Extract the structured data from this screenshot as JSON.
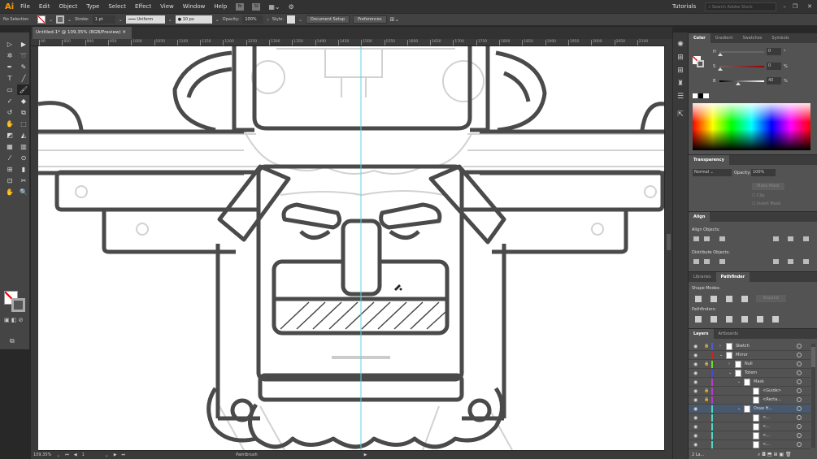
{
  "app": {
    "logo": "Ai",
    "menu": [
      "File",
      "Edit",
      "Object",
      "Type",
      "Select",
      "Effect",
      "View",
      "Window",
      "Help"
    ],
    "bridge": "Br",
    "stock": "St",
    "workspace": "Tutorials",
    "search_placeholder": "Search Adobe Stock"
  },
  "control": {
    "selection": "No Selection",
    "stroke_label": "Stroke:",
    "stroke_weight": "1 pt",
    "profile": "Uniform",
    "brush": "10 px",
    "opacity_label": "Opacity:",
    "opacity": "100%",
    "style_label": "Style:",
    "doc_setup": "Document Setup",
    "preferences": "Preferences"
  },
  "document": {
    "tab_title": "Untitled-1* @ 109,35% (RGB/Preview)",
    "ruler": [
      "00",
      "850",
      "900",
      "950",
      "1000",
      "1050",
      "1100",
      "1150",
      "1200",
      "1250",
      "1300",
      "1350",
      "1400",
      "1450",
      "1500",
      "1550",
      "1600",
      "1650",
      "1700",
      "1750",
      "1800",
      "1850",
      "1900",
      "1950",
      "2000",
      "2050",
      "2100"
    ]
  },
  "status": {
    "zoom": "109,35%",
    "artboard": "1",
    "tool": "Paintbrush"
  },
  "tools": [
    {
      "name": "selection",
      "g": "▷"
    },
    {
      "name": "direct-selection",
      "g": "▶"
    },
    {
      "name": "magic-wand",
      "g": "✲"
    },
    {
      "name": "lasso",
      "g": "➰"
    },
    {
      "name": "pen",
      "g": "✒"
    },
    {
      "name": "curvature",
      "g": "✎"
    },
    {
      "name": "type",
      "g": "T"
    },
    {
      "name": "line-segment",
      "g": "╱"
    },
    {
      "name": "rectangle",
      "g": "▭"
    },
    {
      "name": "paintbrush",
      "g": "🖌",
      "active": true
    },
    {
      "name": "shaper",
      "g": "✓"
    },
    {
      "name": "eraser",
      "g": "◆"
    },
    {
      "name": "rotate",
      "g": "↺"
    },
    {
      "name": "scale",
      "g": "⧉"
    },
    {
      "name": "warp",
      "g": "✋"
    },
    {
      "name": "free-transform",
      "g": "⬚"
    },
    {
      "name": "shape-builder",
      "g": "◩"
    },
    {
      "name": "perspective-grid",
      "g": "◭"
    },
    {
      "name": "mesh",
      "g": "▦"
    },
    {
      "name": "gradient",
      "g": "▥"
    },
    {
      "name": "eyedropper",
      "g": "⁄"
    },
    {
      "name": "blend",
      "g": "⊙"
    },
    {
      "name": "symbol-sprayer",
      "g": "⊞"
    },
    {
      "name": "column-graph",
      "g": "▮"
    },
    {
      "name": "artboard",
      "g": "⊡"
    },
    {
      "name": "slice",
      "g": "✂"
    },
    {
      "name": "hand",
      "g": "✋"
    },
    {
      "name": "zoom",
      "g": "🔍"
    }
  ],
  "color_panel": {
    "tabs": [
      "Color",
      "Gradient",
      "Swatches",
      "Symbols"
    ],
    "sliders": [
      {
        "label": "H",
        "value": "0",
        "unit": "°",
        "level": 0
      },
      {
        "label": "S",
        "value": "0",
        "unit": "%",
        "level": 0
      },
      {
        "label": "B",
        "value": "40",
        "unit": "%",
        "level": 40
      }
    ]
  },
  "transparency": {
    "title": "Transparency",
    "mode": "Normal",
    "opacity_label": "Opacity:",
    "opacity": "100%",
    "make_mask": "Make Mask",
    "clip": "Clip",
    "invert": "Invert Mask"
  },
  "align": {
    "title": "Align",
    "align_objects": "Align Objects:",
    "distribute_objects": "Distribute Objects:"
  },
  "pathfinder": {
    "tabs": [
      "Libraries",
      "Pathfinder"
    ],
    "shape_modes": "Shape Modes:",
    "expand": "Expand",
    "pathfinders": "Pathfinders:"
  },
  "layers": {
    "tabs": [
      "Layers",
      "Artboards"
    ],
    "count": "2 La...",
    "rows": [
      {
        "name": "Sketch",
        "indent": 0,
        "color": "#4a5bd6",
        "lock": true,
        "arrow": "›"
      },
      {
        "name": "Mirror",
        "indent": 0,
        "color": "#c1272d",
        "lock": false,
        "arrow": "⌄"
      },
      {
        "name": "Null",
        "indent": 1,
        "color": "#6adf2a",
        "lock": true,
        "arrow": "›"
      },
      {
        "name": "Totem",
        "indent": 1,
        "color": "#4a4bd0",
        "lock": false,
        "arrow": "⌄"
      },
      {
        "name": "Mask",
        "indent": 2,
        "color": "#b63dc9",
        "lock": false,
        "arrow": "⌄"
      },
      {
        "name": "<Guide>",
        "indent": 3,
        "color": "#b63dc9",
        "lock": true,
        "arrow": ""
      },
      {
        "name": "<Recta...",
        "indent": 3,
        "color": "#b63dc9",
        "lock": true,
        "arrow": ""
      },
      {
        "name": "Draw H...",
        "indent": 2,
        "color": "#4fd8c9",
        "lock": false,
        "arrow": "⌄",
        "selected": true
      },
      {
        "name": "<...",
        "indent": 3,
        "color": "#4fd8c9",
        "lock": false,
        "arrow": ""
      },
      {
        "name": "<...",
        "indent": 3,
        "color": "#4fd8c9",
        "lock": false,
        "arrow": ""
      },
      {
        "name": "<...",
        "indent": 3,
        "color": "#4fd8c9",
        "lock": false,
        "arrow": ""
      },
      {
        "name": "<...",
        "indent": 3,
        "color": "#4fd8c9",
        "lock": false,
        "arrow": ""
      }
    ]
  },
  "colors": {
    "accent": "#ff9a00",
    "guide": "#5fd3e0",
    "stroke": "#4a4a4a",
    "sketch": "#cfcfcf"
  }
}
